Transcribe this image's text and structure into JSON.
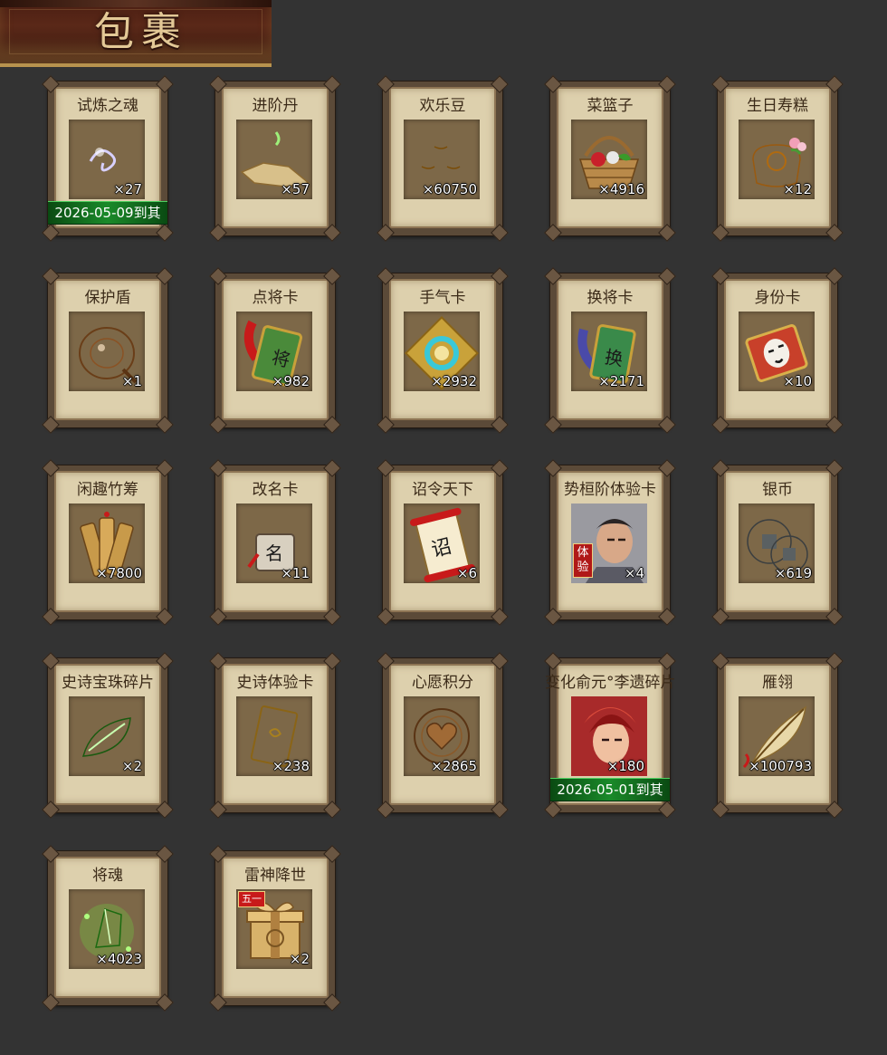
{
  "header": {
    "title": "包裹"
  },
  "items": [
    {
      "name": "试炼之魂",
      "qty": "×27",
      "icon": "dragon-orb-icon",
      "expiry": "2026-05-09到其"
    },
    {
      "name": "进阶丹",
      "qty": "×57",
      "icon": "green-pill-icon"
    },
    {
      "name": "欢乐豆",
      "qty": "×60750",
      "icon": "gold-beans-icon"
    },
    {
      "name": "菜篮子",
      "qty": "×4916",
      "icon": "basket-icon"
    },
    {
      "name": "生日寿糕",
      "qty": "×12",
      "icon": "birthday-cake-icon"
    },
    {
      "name": "保护盾",
      "qty": "×1",
      "icon": "shield-icon"
    },
    {
      "name": "点将卡",
      "qty": "×982",
      "icon": "general-card-icon"
    },
    {
      "name": "手气卡",
      "qty": "×2932",
      "icon": "luck-card-icon"
    },
    {
      "name": "换将卡",
      "qty": "×2171",
      "icon": "swap-general-card-icon"
    },
    {
      "name": "身份卡",
      "qty": "×10",
      "icon": "identity-card-icon"
    },
    {
      "name": "闲趣竹筹",
      "qty": "×7800",
      "icon": "bamboo-tally-icon"
    },
    {
      "name": "改名卡",
      "qty": "×11",
      "icon": "rename-card-icon"
    },
    {
      "name": "诏令天下",
      "qty": "×6",
      "icon": "edict-scroll-icon"
    },
    {
      "name": "势桓阶体验卡",
      "qty": "×4",
      "icon": "hero-portrait-icon",
      "badge": "体验"
    },
    {
      "name": "银币",
      "qty": "×619",
      "icon": "silver-coin-icon"
    },
    {
      "name": "史诗宝珠碎片",
      "qty": "×2",
      "icon": "green-leaf-shard-icon"
    },
    {
      "name": "史诗体验卡",
      "qty": "×238",
      "icon": "golden-card-icon"
    },
    {
      "name": "心愿积分",
      "qty": "×2865",
      "icon": "heart-coin-icon"
    },
    {
      "name": "变化俞元°李遗碎片",
      "qty": "×180",
      "icon": "hero-portrait-red-icon",
      "expiry": "2026-05-01到其"
    },
    {
      "name": "雁翎",
      "qty": "×100793",
      "icon": "feather-icon"
    },
    {
      "name": "将魂",
      "qty": "×4023",
      "icon": "green-crystal-icon"
    },
    {
      "name": "雷神降世",
      "qty": "×2",
      "icon": "gift-box-icon",
      "badge": "五一"
    }
  ]
}
